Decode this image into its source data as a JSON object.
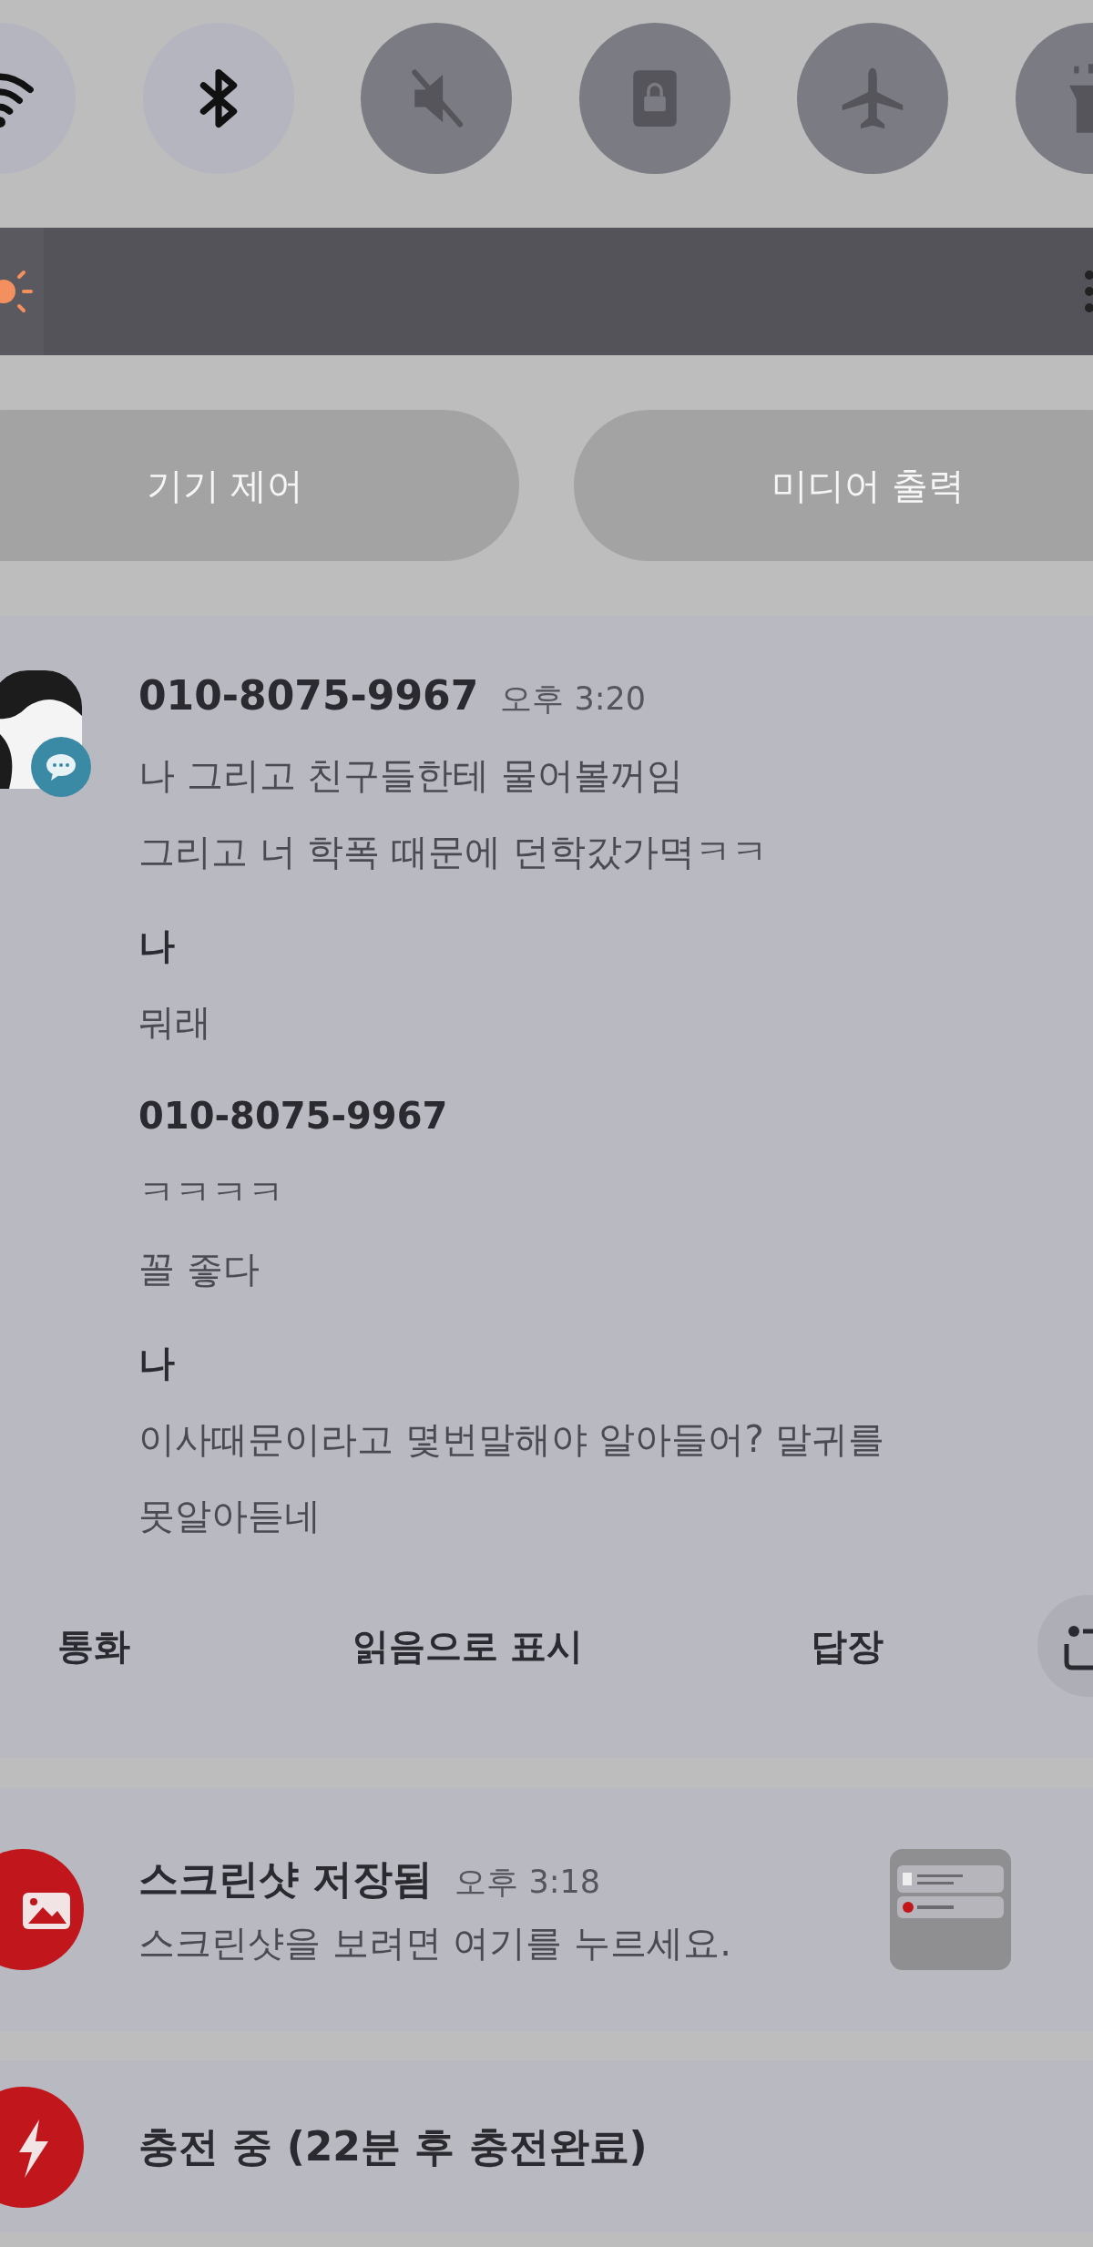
{
  "quick_toggles": [
    {
      "kind": "wifi",
      "on": true
    },
    {
      "kind": "bluetooth",
      "on": true
    },
    {
      "kind": "mute",
      "on": false
    },
    {
      "kind": "rotation_lock",
      "on": false
    },
    {
      "kind": "airplane",
      "on": false
    },
    {
      "kind": "flashlight",
      "on": false
    }
  ],
  "brightness": {
    "level": 0.04
  },
  "control_buttons": [
    "기기 제어",
    "미디어 출력"
  ],
  "message_notification": {
    "title": "010-8075-9967",
    "time": "오후 3:20",
    "lines": [
      {
        "kind": "text",
        "text": "나 그리고 친구들한테 물어볼꺼임"
      },
      {
        "kind": "text",
        "text": "그리고 너 학폭 때문에 던학갔가멱ㅋㅋ"
      },
      {
        "kind": "sender",
        "text": "나"
      },
      {
        "kind": "text",
        "text": "뭐래"
      },
      {
        "kind": "sender",
        "text": "010-8075-9967"
      },
      {
        "kind": "text",
        "text": "ㅋㅋㅋㅋ"
      },
      {
        "kind": "text",
        "text": "꼴 좋다"
      },
      {
        "kind": "sender",
        "text": "나"
      },
      {
        "kind": "text",
        "text": "이사때문이라고 몇번말해야 알아들어? 말귀를 못알아듣네"
      }
    ],
    "actions": [
      "통화",
      "읽음으로 표시",
      "답장"
    ]
  },
  "screenshot_notification": {
    "title": "스크린샷 저장됨",
    "time": "오후 3:18",
    "text": "스크린샷을 보려면 여기를 누르세요."
  },
  "charging_notification": {
    "title": "충전 중 (22분 후 충전완료)"
  }
}
